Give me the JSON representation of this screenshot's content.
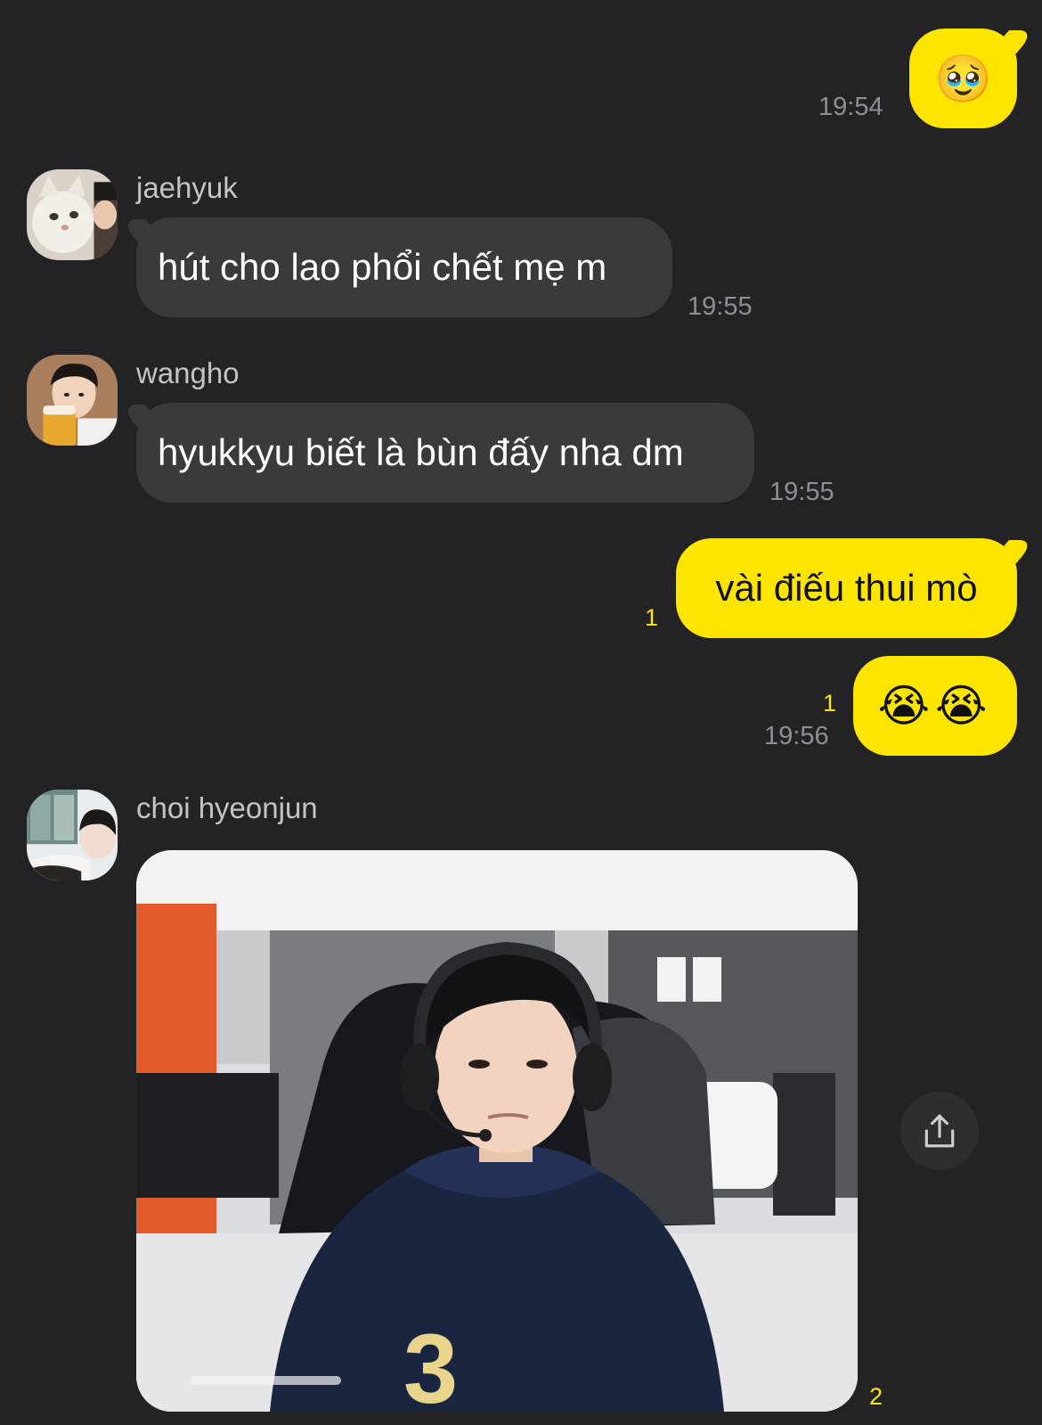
{
  "colors": {
    "background": "#232325",
    "incoming_bubble": "#3a3a3c",
    "outgoing_bubble": "#fee500",
    "unread_count": "#fee500",
    "timestamp": "#8e8e93"
  },
  "messages": [
    {
      "direction": "outgoing",
      "text": "🥹",
      "time": "19:54"
    },
    {
      "direction": "incoming",
      "sender": "jaehyuk",
      "avatar": "cat-avatar",
      "text": "hút cho lao phổi chết mẹ m",
      "time": "19:55"
    },
    {
      "direction": "incoming",
      "sender": "wangho",
      "avatar": "person-beer-avatar",
      "text": "hyukkyu biết là bùn đấy nha dm",
      "time": "19:55"
    },
    {
      "direction": "outgoing",
      "text": "vài điếu thui mò",
      "unread": "1"
    },
    {
      "direction": "outgoing",
      "text": "😭😭",
      "unread": "1",
      "time": "19:56"
    },
    {
      "direction": "incoming",
      "sender": "choi hyeonjun",
      "avatar": "person-selfie-avatar",
      "type": "photo",
      "photo_subject": "person-with-headset-photo",
      "unread": "2"
    }
  ],
  "share_button": {
    "icon": "share-icon"
  }
}
